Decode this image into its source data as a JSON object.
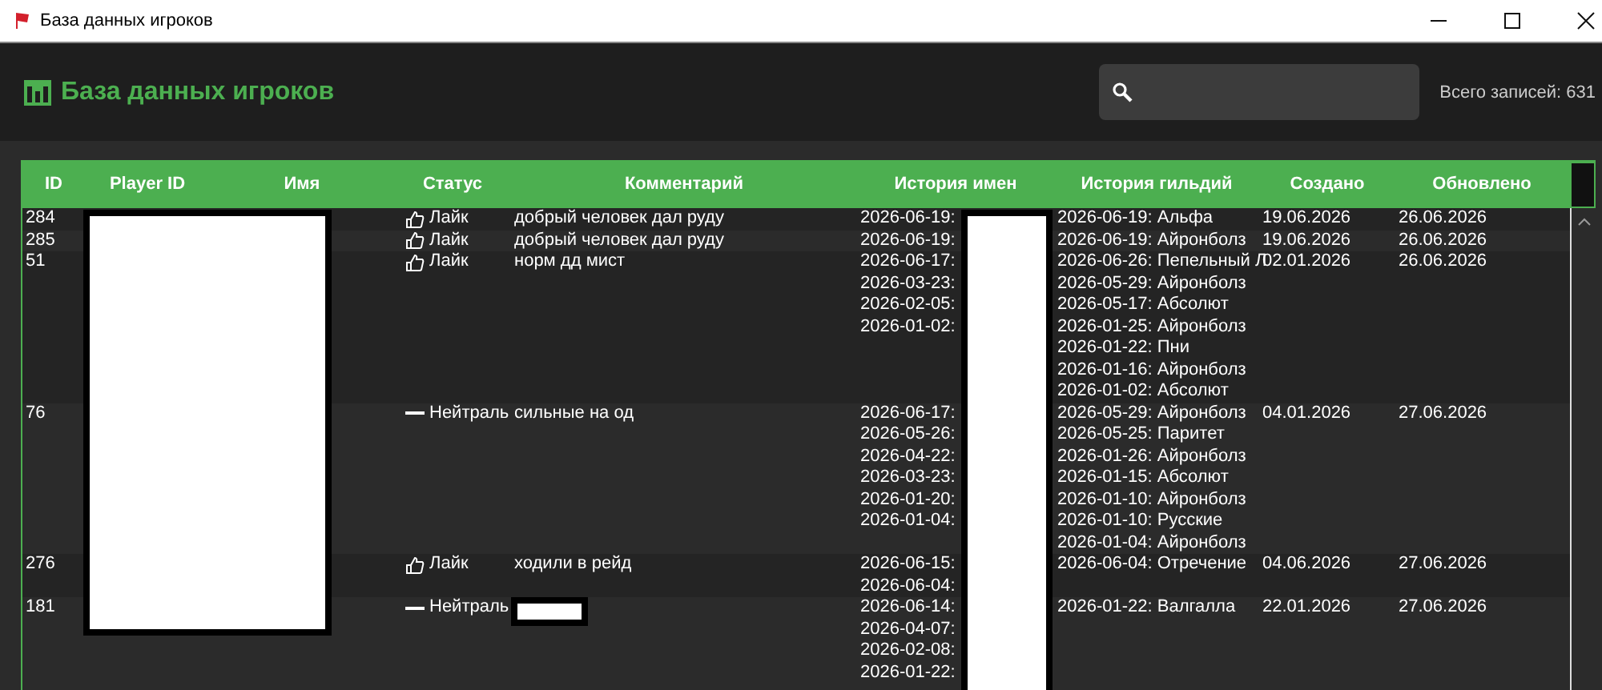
{
  "window": {
    "title": "База данных игроков"
  },
  "header": {
    "title": "База данных игроков",
    "search": {
      "kind": "field"
    },
    "total": "Всего записей: 631"
  },
  "table": {
    "columns": [
      "ID",
      "Player ID",
      "Имя",
      "Статус",
      "Комментарий",
      "История имен",
      "История гильдий",
      "Создано",
      "Обновлено"
    ],
    "rows": [
      {
        "id": "284",
        "status": {
          "kind": "like",
          "label": "Лайк"
        },
        "comment": "добрый человек дал руду",
        "names": [
          "2026-06-19:"
        ],
        "guilds": [
          "2026-06-19: Альфа"
        ],
        "created": "19.06.2026",
        "updated": "26.06.2026"
      },
      {
        "id": "285",
        "status": {
          "kind": "like",
          "label": "Лайк"
        },
        "comment": "добрый человек дал руду",
        "names": [
          "2026-06-19:"
        ],
        "guilds": [
          "2026-06-19: Айронболз"
        ],
        "created": "19.06.2026",
        "updated": "26.06.2026"
      },
      {
        "id": "51",
        "status": {
          "kind": "like",
          "label": "Лайк"
        },
        "comment": "норм дд мист",
        "names": [
          "2026-06-17:",
          "2026-03-23:",
          "2026-02-05:",
          "2026-01-02:"
        ],
        "guilds": [
          "2026-06-26: Пепельный Л",
          "2026-05-29: Айронболз",
          "2026-05-17: Абсолют",
          "2026-01-25: Айронболз",
          "2026-01-22: Пни",
          "2026-01-16: Айронболз",
          "2026-01-02: Абсолют"
        ],
        "created": "02.01.2026",
        "updated": "26.06.2026"
      },
      {
        "id": "76",
        "status": {
          "kind": "neutral",
          "label": "Нейтраль"
        },
        "comment": "сильные на од",
        "names": [
          "2026-06-17:",
          "2026-05-26:",
          "2026-04-22:",
          "2026-03-23:",
          "2026-01-20:",
          "2026-01-04:"
        ],
        "guilds": [
          "2026-05-29: Айронболз",
          "2026-05-25: Паритет",
          "2026-01-26: Айронболз",
          "2026-01-15: Абсолют",
          "2026-01-10: Айронболз",
          "2026-01-10: Русские",
          "2026-01-04: Айронболз"
        ],
        "created": "04.01.2026",
        "updated": "27.06.2026"
      },
      {
        "id": "276",
        "status": {
          "kind": "like",
          "label": "Лайк"
        },
        "comment": "ходили в рейд",
        "names": [
          "2026-06-15:",
          "2026-06-04:"
        ],
        "guilds": [
          "2026-06-04: Отречение"
        ],
        "created": "04.06.2026",
        "updated": "27.06.2026"
      },
      {
        "id": "181",
        "status": {
          "kind": "neutral",
          "label": "Нейтраль"
        },
        "comment_redacted": true,
        "names": [
          "2026-06-14:",
          "2026-04-07:",
          "2026-02-08:",
          "2026-01-22:"
        ],
        "guilds": [
          "2026-01-22: Валгалла"
        ],
        "created": "22.01.2026",
        "updated": "27.06.2026"
      }
    ]
  }
}
